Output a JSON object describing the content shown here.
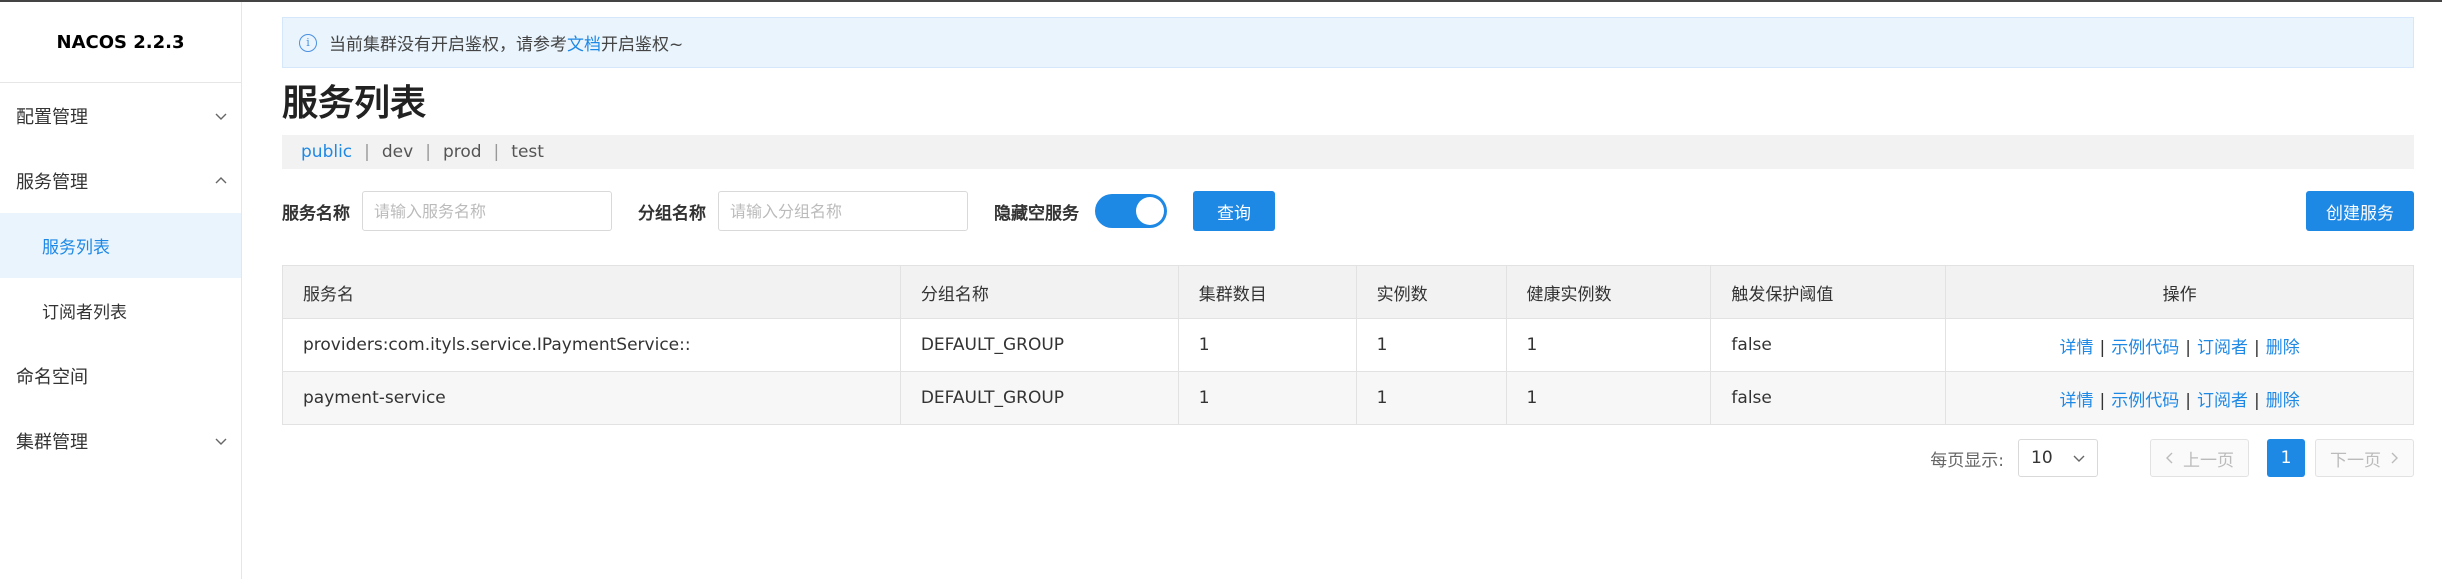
{
  "app": {
    "title": "NACOS 2.2.3"
  },
  "sidebar": {
    "items": [
      {
        "label": "配置管理",
        "expandable": true
      },
      {
        "label": "服务管理",
        "expandable": true
      },
      {
        "label": "服务列表",
        "sub": true,
        "active": true
      },
      {
        "label": "订阅者列表",
        "sub": true
      },
      {
        "label": "命名空间"
      },
      {
        "label": "集群管理",
        "expandable": true
      }
    ]
  },
  "notice": {
    "prefix": "当前集群没有开启鉴权，请参考",
    "link": "文档",
    "suffix": "开启鉴权~"
  },
  "page": {
    "title": "服务列表"
  },
  "namespaces": [
    "public",
    "dev",
    "prod",
    "test"
  ],
  "search": {
    "service_name_label": "服务名称",
    "service_name_placeholder": "请输入服务名称",
    "group_name_label": "分组名称",
    "group_name_placeholder": "请输入分组名称",
    "hide_empty_label": "隐藏空服务",
    "hide_empty_on": true,
    "query_button": "查询",
    "create_button": "创建服务"
  },
  "table": {
    "headers": [
      "服务名",
      "分组名称",
      "集群数目",
      "实例数",
      "健康实例数",
      "触发保护阈值",
      "操作"
    ],
    "rows": [
      [
        "providers:com.ityls.service.IPaymentService::",
        "DEFAULT_GROUP",
        "1",
        "1",
        "1",
        "false"
      ],
      [
        "payment-service",
        "DEFAULT_GROUP",
        "1",
        "1",
        "1",
        "false"
      ]
    ],
    "actions": [
      "详情",
      "示例代码",
      "订阅者",
      "删除"
    ]
  },
  "pagination": {
    "per_page_label": "每页显示:",
    "page_size": "10",
    "prev": "上一页",
    "current_page": "1",
    "next": "下一页"
  },
  "colors": {
    "primary": "#1e88e5",
    "notice_bg": "#e9f4fd"
  }
}
